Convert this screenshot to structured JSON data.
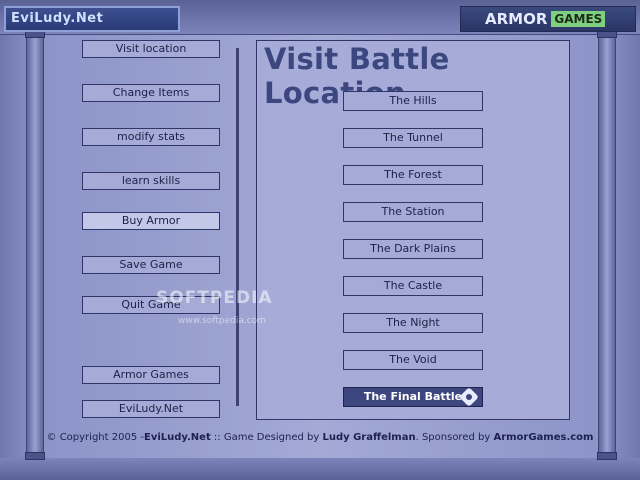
{
  "header": {
    "left_logo": "EviLudy.Net",
    "right_logo_part1": "ARMOR",
    "right_logo_part2": "GAMES"
  },
  "menu": [
    {
      "label": "Visit location",
      "active": false
    },
    {
      "label": "Change Items",
      "active": false
    },
    {
      "label": "modify stats",
      "active": false
    },
    {
      "label": "learn skills",
      "active": false
    },
    {
      "label": "Buy Armor",
      "active": true
    },
    {
      "label": "Save Game",
      "active": false
    },
    {
      "label": "Quit Game",
      "active": false
    },
    {
      "label": "Armor Games",
      "active": false
    },
    {
      "label": "EviLudy.Net",
      "active": false
    }
  ],
  "panel": {
    "title": "Visit Battle Location",
    "locations": [
      {
        "label": "The Hills",
        "selected": false
      },
      {
        "label": "The Tunnel",
        "selected": false
      },
      {
        "label": "The Forest",
        "selected": false
      },
      {
        "label": "The Station",
        "selected": false
      },
      {
        "label": "The Dark Plains",
        "selected": false
      },
      {
        "label": "The Castle",
        "selected": false
      },
      {
        "label": "The Night",
        "selected": false
      },
      {
        "label": "The Void",
        "selected": false
      },
      {
        "label": "The Final Battle",
        "selected": true
      }
    ]
  },
  "footer": {
    "part1": "© Copyright 2005 -",
    "part2": "EviLudy.Net",
    "part3": " :: Game Designed by ",
    "part4": "Ludy Graffelman",
    "part5": ". Sponsored by ",
    "part6": "ArmorGames.com"
  },
  "watermark": {
    "main": "SOFTPEDIA",
    "sub": "www.softpedia.com"
  }
}
